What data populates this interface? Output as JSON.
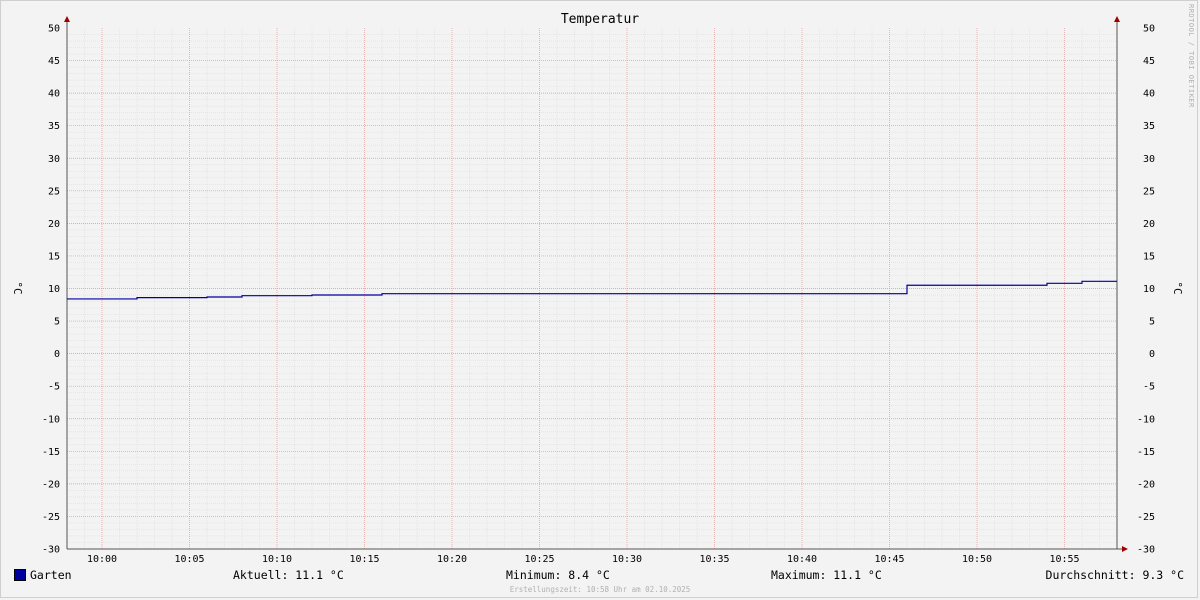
{
  "chart_data": {
    "type": "line",
    "title": "Temperatur",
    "ylabel": "°C",
    "ylabel_right": "°C",
    "ylim": [
      -30,
      50
    ],
    "yticks": [
      50,
      45,
      40,
      35,
      30,
      25,
      20,
      15,
      10,
      5,
      0,
      -5,
      -10,
      -15,
      -20,
      -25,
      -30
    ],
    "xlim": [
      "09:58",
      "10:58"
    ],
    "xticks": [
      "10:00",
      "10:05",
      "10:10",
      "10:15",
      "10:20",
      "10:25",
      "10:30",
      "10:35",
      "10:40",
      "10:45",
      "10:50",
      "10:55"
    ],
    "grid": true,
    "legend_position": "bottom-left",
    "series": [
      {
        "name": "Garten",
        "color": "#0000a0",
        "x": [
          "09:58",
          "10:02",
          "10:06",
          "10:08",
          "10:12",
          "10:16",
          "10:46",
          "10:54",
          "10:56",
          "10:58"
        ],
        "y": [
          8.4,
          8.6,
          8.7,
          8.9,
          9.0,
          9.2,
          10.5,
          10.8,
          11.1,
          11.1
        ],
        "step": true
      }
    ]
  },
  "legend": {
    "series_name": "Garten",
    "swatch_color": "#0000a0",
    "current": "Aktuell: 11.1 °C",
    "minimum": "Minimum: 8.4 °C",
    "maximum": "Maximum: 11.1 °C",
    "average": "Durchschnitt: 9.3 °C"
  },
  "watermark": "RRDTOOL / TOBI OETIKER",
  "footer": "Erstellungszeit: 10:58 Uhr am 02.10.2025"
}
